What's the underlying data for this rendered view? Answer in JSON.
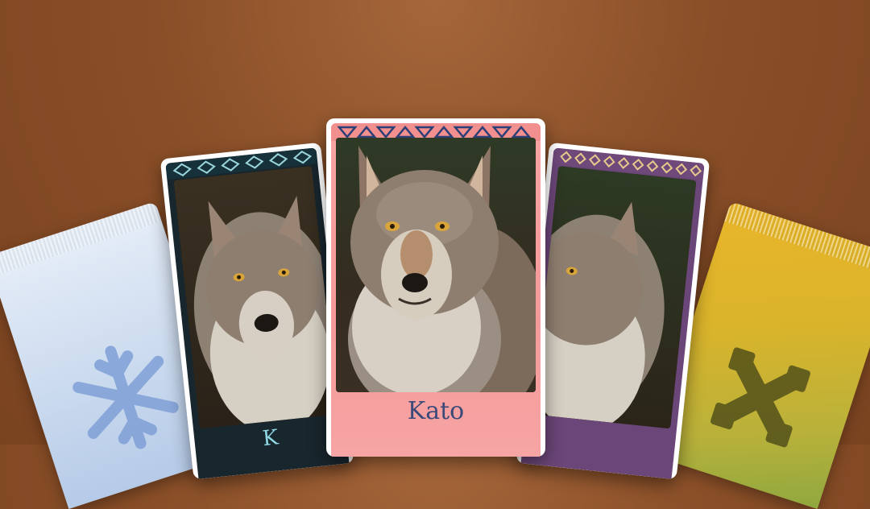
{
  "background_color": "#8a4f28",
  "packs": [
    {
      "id": "blue",
      "color": "#c9d9ee",
      "icon": "snowflake-icon"
    },
    {
      "id": "yellow",
      "color": "#dab42b",
      "icon": "leaf-cross-icon"
    }
  ],
  "cards": {
    "left": {
      "name": "K",
      "accent": "#8fd7e2"
    },
    "center": {
      "name": "Kato",
      "accent": "#3c4a7a"
    },
    "right": {
      "name": "",
      "accent": "#f0d6ff"
    }
  }
}
